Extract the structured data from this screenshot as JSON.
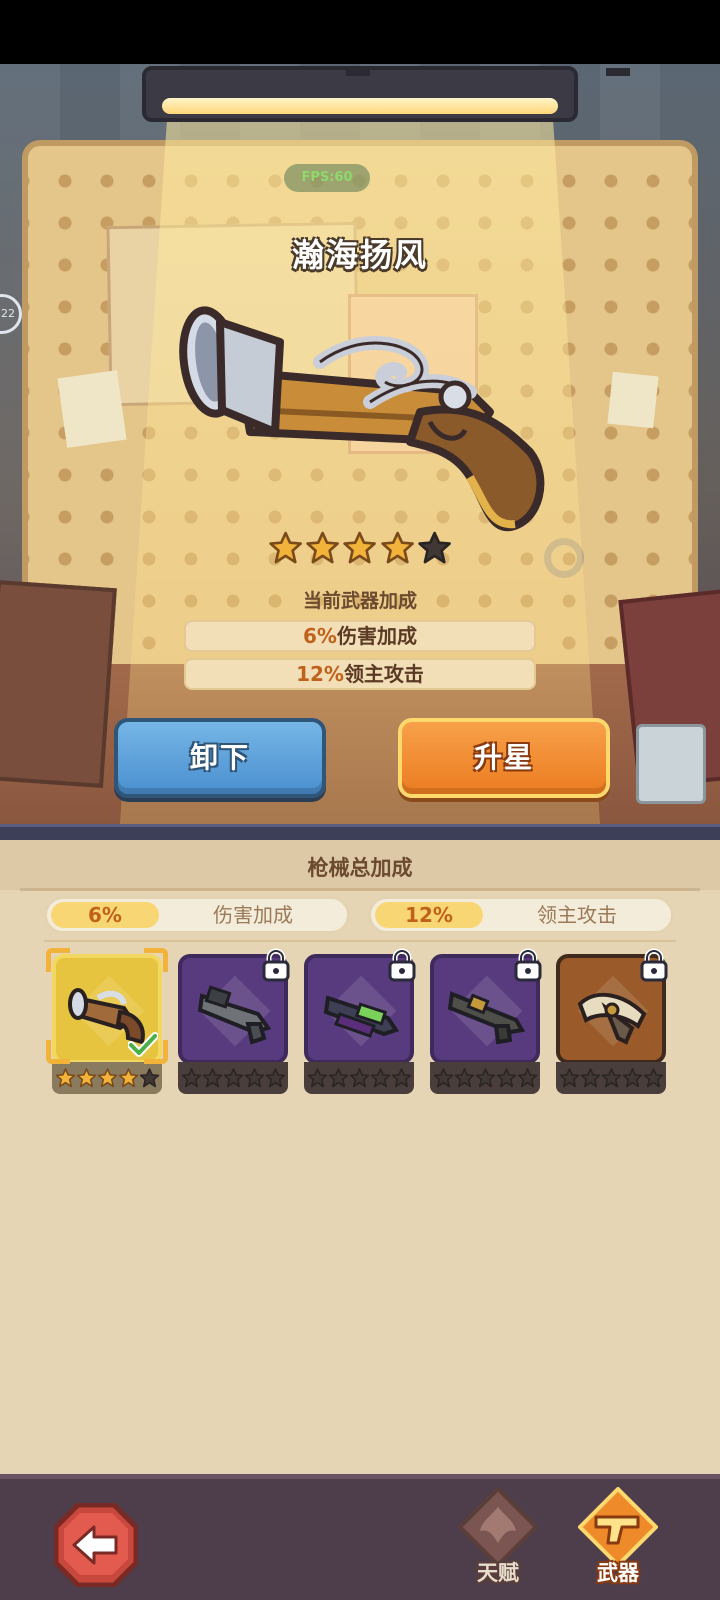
{
  "hud": {
    "fps": "FPS:60"
  },
  "weapon": {
    "name": "瀚海扬风",
    "stars_filled": 4,
    "stars_total": 5,
    "bonus_heading": "当前武器加成",
    "bonuses": [
      {
        "value": "6%",
        "label": "伤害加成"
      },
      {
        "value": "12%",
        "label": "领主攻击"
      }
    ]
  },
  "actions": {
    "unequip": "卸下",
    "upgrade_star": "升星"
  },
  "totals": {
    "title": "枪械总加成",
    "damage": {
      "value": "6%",
      "label": "伤害加成"
    },
    "lord_attack": {
      "value": "12%",
      "label": "领主攻击"
    }
  },
  "weapons_list": [
    {
      "icon": "flintlock-pistol-icon",
      "rarity": "gold",
      "stars": 4,
      "locked": false,
      "equipped": true
    },
    {
      "icon": "grenade-launcher-icon",
      "rarity": "purple",
      "stars": 0,
      "locked": true,
      "equipped": false
    },
    {
      "icon": "plasma-rifle-icon",
      "rarity": "purple",
      "stars": 0,
      "locked": true,
      "equipped": false
    },
    {
      "icon": "rocket-launcher-icon",
      "rarity": "purple",
      "stars": 0,
      "locked": true,
      "equipped": false
    },
    {
      "icon": "crossbow-gun-icon",
      "rarity": "orange",
      "stars": 0,
      "locked": true,
      "equipped": false
    }
  ],
  "nav": {
    "talent": "天赋",
    "weapon": "武器",
    "active": "weapon"
  },
  "colors": {
    "accent_orange": "#ec7c21",
    "button_blue": "#4a8fcf",
    "star_gold": "#f2b33a",
    "panel_bg": "#e6d5b5"
  }
}
